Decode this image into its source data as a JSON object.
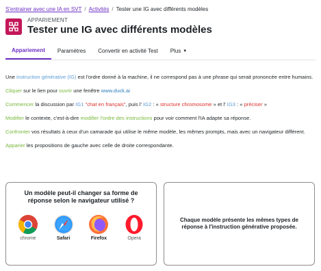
{
  "breadcrumb": {
    "items": [
      "S'entrainer avec une IA en SVT",
      "Activités",
      "Tester une IG avec différents modèles"
    ]
  },
  "header": {
    "eyebrow": "APPARIEMENT",
    "title": "Tester une IG avec différents modèles",
    "icon": "matching-activity-icon",
    "icon_color": "#c3175a"
  },
  "tabs": [
    {
      "label": "Appariement",
      "active": true
    },
    {
      "label": "Paramètres",
      "active": false
    },
    {
      "label": "Convertir en activité Test",
      "active": false
    },
    {
      "label": "Plus",
      "active": false
    }
  ],
  "content": {
    "p1": {
      "pre": "Une ",
      "kw": "instruction générative (IG)",
      "post": " est l'ordre donné à la machine, il ne correspond pas à une phrase qui serait prononcée entre humains."
    },
    "p2": {
      "kw1": "Cliquer",
      "t1": " sur le lien pour ",
      "kw2": "ouvrir",
      "t2": " une fenêtre ",
      "link": "www.duck.ai"
    },
    "p3": {
      "kw1": "Commencer",
      "t1": " la discussion par ",
      "ig1": "IG1",
      "q1": "\"chat en français\"",
      "t2": ",  puis l' ",
      "ig2": "IG2",
      "t3": " : « ",
      "q2": "structure chromosome",
      "t4": " » et l' ",
      "ig3": "IG3",
      "t5": " : « ",
      "q3": "préciser",
      "t6": " »"
    },
    "p4": {
      "kw1": "Modifier",
      "t1": " le contexte, c'est-à-dire ",
      "kw2": "modifier l'ordre des instructions",
      "t2": " pour voir comment l'IA adapte sa réponse."
    },
    "p5": {
      "kw": "Confronter",
      "t": " vos résultats à ceux d'un camarade qui utilise le même modèle, les mêmes prompts, mais avec un navigateur différent."
    },
    "p6": {
      "kw": "Apparier",
      "t": " les propositions de gauche avec celle de droite correspondante."
    }
  },
  "left_box": {
    "title": "Un modèle peut-il changer sa forme de réponse selon le navigateur utilisé ?",
    "browsers": [
      {
        "label": "chrome",
        "icon": "chrome-icon"
      },
      {
        "label": "Safari",
        "icon": "safari-icon"
      },
      {
        "label": "Firefox",
        "icon": "firefox-icon"
      },
      {
        "label": "Opera",
        "icon": "opera-icon"
      }
    ]
  },
  "right_box": {
    "text": "Chaque modèle présente les mêmes types de réponse à l'instruction générative proposée."
  },
  "colors": {
    "accent": "#6d2fc3",
    "keyword_blue": "#5b9bd5",
    "keyword_green": "#78b83a",
    "keyword_red": "#d9302b"
  }
}
